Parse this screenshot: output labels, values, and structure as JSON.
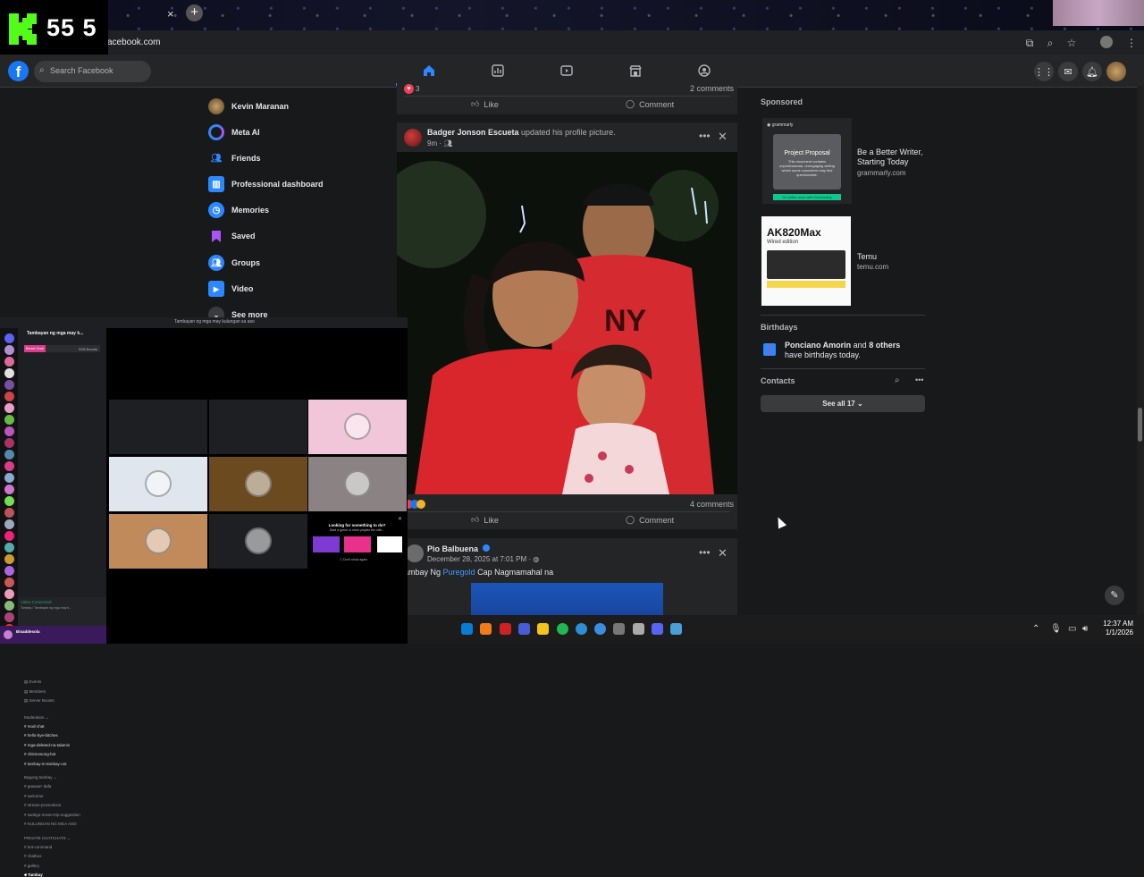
{
  "stream": {
    "badge_label": "K",
    "viewer_count": "55 5"
  },
  "browser": {
    "url": "acebook.com",
    "tab_close": "×",
    "new_tab": "+"
  },
  "facebook": {
    "search_placeholder": "Search Facebook",
    "left_nav": [
      {
        "label": "Kevin Maranan",
        "icon": "avatar"
      },
      {
        "label": "Meta AI",
        "icon": "meta-ai-icon"
      },
      {
        "label": "Friends",
        "icon": "friends-icon"
      },
      {
        "label": "Professional dashboard",
        "icon": "dashboard-icon"
      },
      {
        "label": "Memories",
        "icon": "memories-icon"
      },
      {
        "label": "Saved",
        "icon": "saved-icon"
      },
      {
        "label": "Groups",
        "icon": "groups-icon"
      },
      {
        "label": "Video",
        "icon": "video-icon"
      },
      {
        "label": "See more",
        "icon": "chevron-down-icon"
      }
    ],
    "post1": {
      "reaction_count": "3",
      "comments": "2 comments",
      "like": "Like",
      "comment": "Comment"
    },
    "post2": {
      "author": "Badger Jonson Escueta",
      "action": "updated his profile picture.",
      "time": "9m",
      "comments": "4 comments",
      "like": "Like",
      "comment": "Comment"
    },
    "post3": {
      "author": "Pio Balbuena",
      "date": "December 28, 2025 at 7:01 PM",
      "text_pre": "ambay Ng ",
      "text_link": "Puregold",
      "text_post": " Cap Nagmamahal na"
    },
    "sponsored": {
      "header": "Sponsored",
      "ads": [
        {
          "title": "Be a Better Writer, Starting Today",
          "domain": "grammarly.com",
          "brand": "grammarly",
          "card_title": "Project Proposal",
          "card_text": "This document contains unprofessional, unengaging writing which some coworkers may find questionable.",
          "cta": "Do better work with Grammarly"
        },
        {
          "title": "Temu",
          "domain": "temu.com",
          "product": "AK820Max",
          "product_sub": "Wired edition"
        }
      ]
    },
    "birthdays": {
      "header": "Birthdays",
      "name": "Ponciano Amorin",
      "mid": " and ",
      "others": "8 others",
      "tail": " have birthdays today."
    },
    "contacts": {
      "header": "Contacts",
      "see_all": "See all 17"
    }
  },
  "discord": {
    "window_title": "Tambayan ng mga may kulungan sa aso",
    "server": "Tambayan ng mga may k...",
    "boost_label": "Boost Goal",
    "boost_count": "9/28 Boosts",
    "top_items": [
      "Events",
      "Members",
      "Server Boosts"
    ],
    "cat1": "Moderation",
    "channels1": [
      "mod-chat",
      "hello-bye-bitches",
      "mga-deleted-na-talamis",
      "chismosong-bot",
      "tambay-in-tambay-out"
    ],
    "cat2": "Bagong tambay",
    "channels2": [
      "gawaan' dafa",
      "welcome",
      "stream-promotions",
      "santigo-movie-trip-suggestion",
      "KULUNGAN NG MGA ASO"
    ],
    "cat3": "PRIVATE CHATCHATS",
    "channels3": [
      "bot-command",
      "chatbox",
      "gallery",
      "Tambay"
    ],
    "voice_status": "Video Connected",
    "voice_sub": "Tambay / Tambayan ng mga may k...",
    "user": "Bisaddesola",
    "activity_title": "Looking for something to do?",
    "activity_sub": "Start a game or video playlist live with...",
    "dont_show": "Don't show again",
    "tile_colors": [
      "#1e1f22",
      "#1e1f22",
      "#f1c6d8",
      "#dfe6ee",
      "#6a4a1e",
      "#8b8383",
      "#c08a5a",
      "#1e1f22"
    ]
  },
  "taskbar": {
    "time": "12:37 AM",
    "date": "1/1/2026"
  },
  "colors": {
    "fb_blue": "#1877f2",
    "kick_green": "#53fc18",
    "discord_blurple": "#5865f2"
  }
}
